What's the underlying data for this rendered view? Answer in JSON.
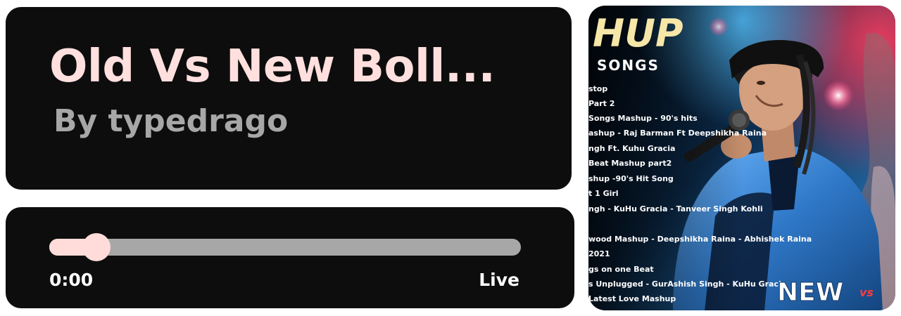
{
  "now_playing": {
    "title": "Old Vs New Boll...",
    "author": "By typedrago"
  },
  "player": {
    "current_time": "0:00",
    "duration_label": "Live",
    "progress_fraction": 0.1
  },
  "cover": {
    "heading": "HUP",
    "subheading": "SONGS",
    "new_label": "NEW",
    "vs_label": "vs",
    "tracklist": [
      "stop",
      "Part 2",
      "Songs Mashup - 90's hits",
      "ashup - Raj Barman Ft Deepshikha Raina",
      "ngh Ft. Kuhu Gracia",
      "Beat Mashup part2",
      "shup -90's Hit Song",
      "t 1 Girl",
      "ngh - KuHu Gracia - Tanveer Singh Kohli",
      "wood Mashup - Deepshikha Raina - Abhishek Raina",
      "2021",
      "gs on one Beat",
      "s Unplugged - GurAshish Singh - KuHu Gracia",
      "Latest Love Mashup"
    ]
  },
  "colors": {
    "card_bg": "#0d0d0d",
    "title": "#ffe0de",
    "author": "#a7a7a7",
    "accent": "#ffdcd9",
    "track": "#a7a7a7",
    "time_text": "#ffffff"
  }
}
